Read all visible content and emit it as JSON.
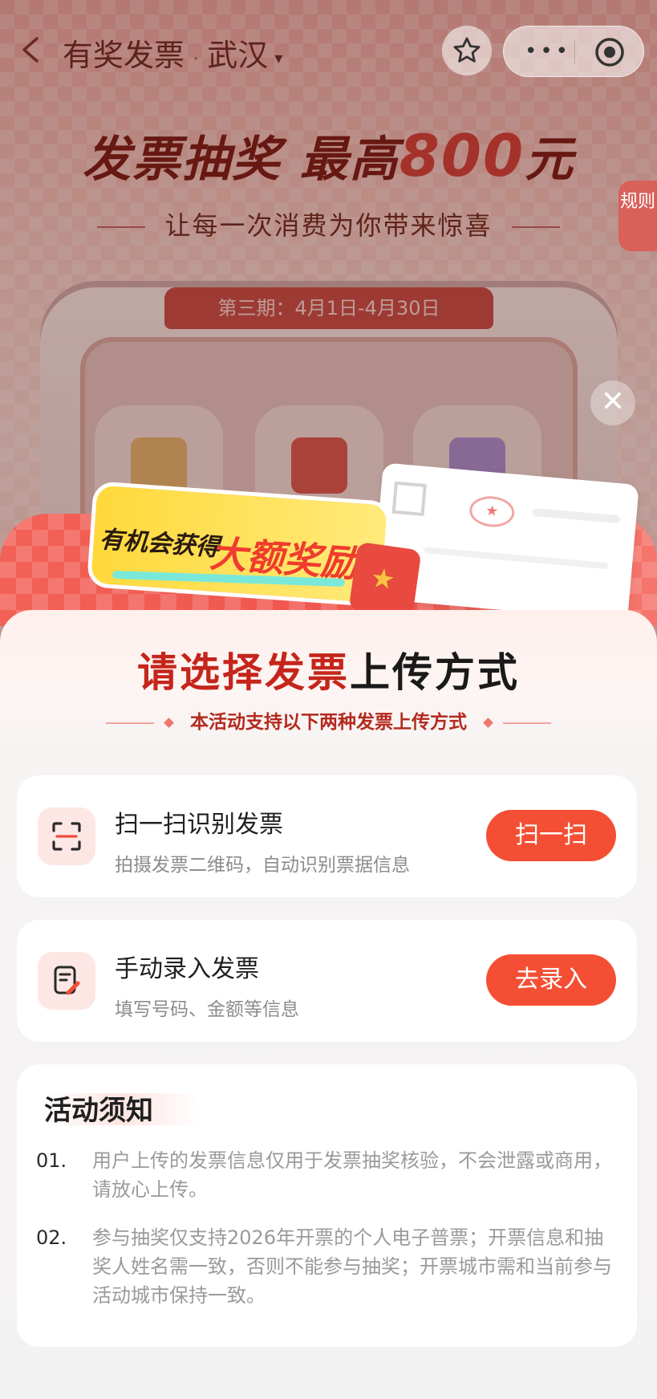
{
  "nav": {
    "title": "有奖发票",
    "separator": "·",
    "city": "武汉",
    "caret": "▾",
    "more": "•••"
  },
  "hero": {
    "title_prefix": "发票抽奖 最高",
    "title_amount": "800",
    "title_suffix": "元",
    "subtitle": "让每一次消费为你带来惊喜",
    "period": "第三期：4月1日-4月30日",
    "rules": "规则"
  },
  "promo": {
    "text_part1": "有机会获得",
    "text_part2": "大额奖励"
  },
  "sheet": {
    "title_highlight": "请选择发票",
    "title_rest": "上传方式",
    "subtitle": "本活动支持以下两种发票上传方式"
  },
  "options": [
    {
      "title": "扫一扫识别发票",
      "desc": "拍摄发票二维码，自动识别票据信息",
      "button": "扫一扫"
    },
    {
      "title": "手动录入发票",
      "desc": "填写号码、金额等信息",
      "button": "去录入"
    }
  ],
  "notice": {
    "title": "活动须知",
    "items": [
      {
        "num": "01.",
        "text": "用户上传的发票信息仅用于发票抽奖核验，不会泄露或商用，请放心上传。"
      },
      {
        "num": "02.",
        "text": "参与抽奖仅支持2026年开票的个人电子普票；开票信息和抽奖人姓名需一致，否则不能参与抽奖；开票城市需和当前参与活动城市保持一致。"
      }
    ]
  },
  "colors": {
    "accent": "#f44f34",
    "title_red": "#c5251b",
    "background": "#f3f2f2"
  },
  "icons": {
    "back": "chevron-left-icon",
    "favorite": "star-icon",
    "more": "more-icon",
    "close_app": "target-icon",
    "close_popup": "close-icon",
    "scan": "scan-icon",
    "manual": "edit-document-icon"
  }
}
